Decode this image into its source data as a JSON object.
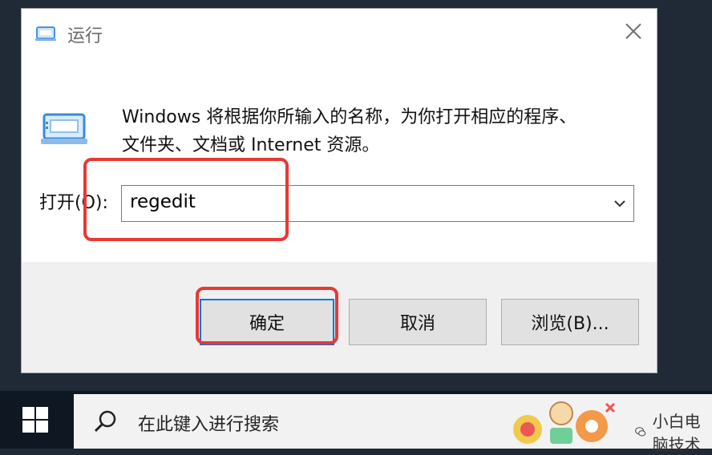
{
  "window": {
    "title": "运行",
    "description_line1": "Windows 将根据你所输入的名称，为你打开相应的程序、",
    "description_line2": "文件夹、文档或 Internet 资源。",
    "open_label": "打开(O):",
    "input_value": "regedit",
    "buttons": {
      "ok": "确定",
      "cancel": "取消",
      "browse": "浏览(B)..."
    }
  },
  "taskbar": {
    "search_placeholder": "在此键入进行搜索"
  },
  "watermark": {
    "text": "小白电脑技术"
  },
  "icons": {
    "title": "run-icon",
    "dialog": "run-icon",
    "close": "close-icon",
    "dropdown": "chevron-down-icon",
    "start": "windows-logo-icon",
    "search": "search-icon",
    "watermark": "wechat-icon"
  },
  "colors": {
    "annotation": "#e53935",
    "accent": "#0078d7",
    "taskbar": "#0f1822"
  }
}
